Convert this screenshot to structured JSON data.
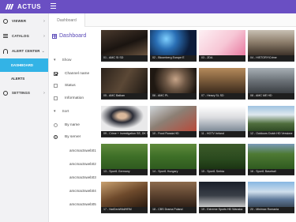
{
  "app": {
    "logo_text": "ACTUS"
  },
  "sidebar": {
    "items": [
      {
        "label": "VIEWER",
        "icon": "eye-icon",
        "chevron": "›"
      },
      {
        "label": "CATALOG",
        "icon": "catalog-icon",
        "chevron": "›"
      },
      {
        "label": "ALERT CENTER",
        "icon": "bell-icon",
        "chevron": "⌄"
      },
      {
        "label": "DASHBOARD",
        "sub": true,
        "active": true
      },
      {
        "label": "ALERTS",
        "sub": true
      },
      {
        "label": "SETTINGS",
        "icon": "gear-icon",
        "chevron": "›"
      }
    ]
  },
  "tabs": [
    {
      "label": "Dashboard"
    }
  ],
  "filters": {
    "title": "Dashboard",
    "show_label": "Show",
    "show_options": [
      {
        "label": "Channel name",
        "checked": true
      },
      {
        "label": "Status",
        "checked": false
      },
      {
        "label": "Information",
        "checked": false
      }
    ],
    "sort_label": "Sort",
    "sort_options": [
      {
        "label": "By name",
        "selected": false
      },
      {
        "label": "By server",
        "selected": true
      }
    ],
    "servers": [
      "amcmactsweb01",
      "amcmactsweb02",
      "amcmactsweb03",
      "amcmactsweb04",
      "amcmactsweb05"
    ]
  },
  "tiles": [
    {
      "caption": "01 - AMC SI SD",
      "scene": "dark-room"
    },
    {
      "caption": "02 - Bloomberg Europe E",
      "scene": "blue-promo"
    },
    {
      "caption": "03 - ZDA",
      "scene": "eva-pink"
    },
    {
      "caption": "04 - HISTORY/Crime",
      "scene": "crowd"
    },
    {
      "caption": "05 - AMC Balkan",
      "scene": "dark-interior"
    },
    {
      "caption": "06 - AMC PL",
      "scene": "face-closeup"
    },
    {
      "caption": "07 - Heavy SL SD",
      "scene": "warm-hall"
    },
    {
      "caption": "08 - AMC ME HD",
      "scene": "grey-city"
    },
    {
      "caption": "09 - Crime + Investigation SE, DK SFT",
      "scene": "suit-man"
    },
    {
      "caption": "10 - Food Russia HD",
      "scene": "kitchen"
    },
    {
      "caption": "11 - HGTV Ireland",
      "scene": "bright-room"
    },
    {
      "caption": "12 - Outdoors Dutch HD Versione",
      "scene": "mountain"
    },
    {
      "caption": "13 - Sport1 Germany",
      "scene": "pitch"
    },
    {
      "caption": "14 - Sport1 Hungary",
      "scene": "pitch"
    },
    {
      "caption": "15 - Sport1 Serbia",
      "scene": "pitch-dark"
    },
    {
      "caption": "16 - Sport1 Baseball",
      "scene": "pitch-far"
    },
    {
      "caption": "17 - NatGeoWild/HRM",
      "scene": "cartoon"
    },
    {
      "caption": "18 - CBS Drama Poland",
      "scene": "crowd-brown"
    },
    {
      "caption": "19 - Extreme Sports HD Wanaka",
      "scene": "road-night"
    },
    {
      "caption": "20 - Minimax Romania",
      "scene": "train"
    }
  ]
}
